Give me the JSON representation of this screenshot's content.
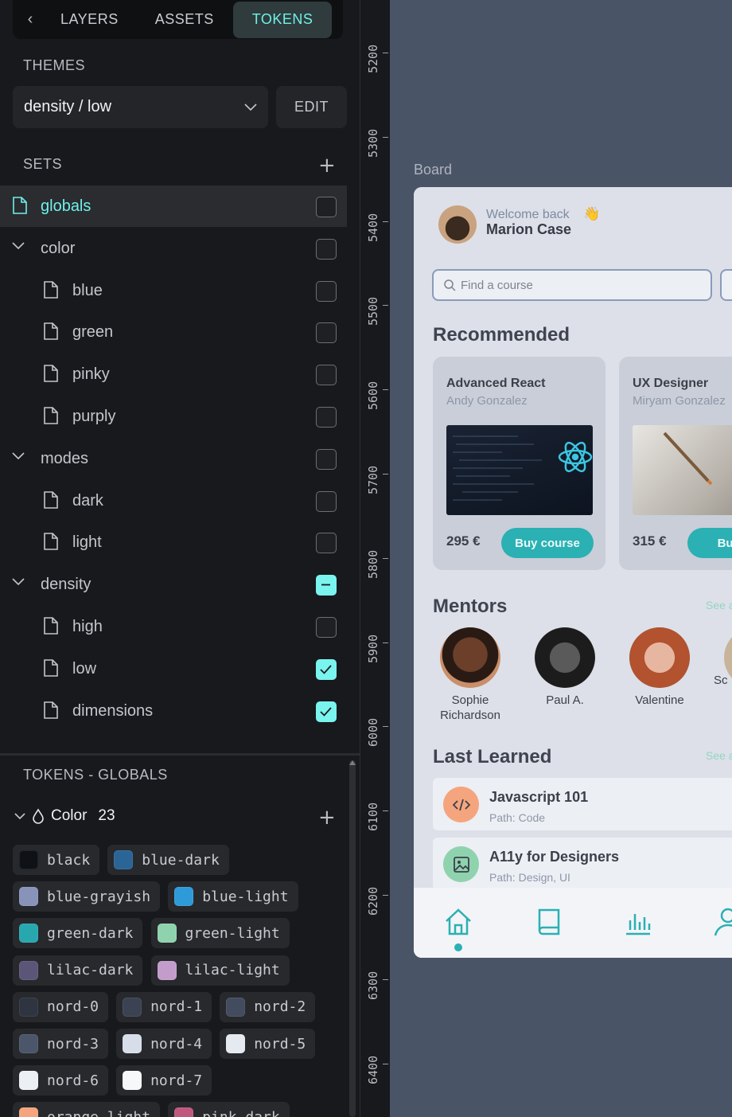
{
  "tabs": {
    "back": "‹",
    "layers": "LAYERS",
    "assets": "ASSETS",
    "tokens": "TOKENS"
  },
  "themes": {
    "title": "THEMES",
    "selected": "density / low",
    "edit": "EDIT"
  },
  "sets": {
    "title": "SETS",
    "items": [
      {
        "label": "globals",
        "type": "file",
        "state": "empty",
        "selected": true
      },
      {
        "label": "color",
        "type": "group",
        "state": "empty"
      },
      {
        "label": "blue",
        "type": "file",
        "state": "empty"
      },
      {
        "label": "green",
        "type": "file",
        "state": "empty"
      },
      {
        "label": "pinky",
        "type": "file",
        "state": "empty"
      },
      {
        "label": "purply",
        "type": "file",
        "state": "empty"
      },
      {
        "label": "modes",
        "type": "group",
        "state": "empty"
      },
      {
        "label": "dark",
        "type": "file",
        "state": "empty"
      },
      {
        "label": "light",
        "type": "file",
        "state": "empty"
      },
      {
        "label": "density",
        "type": "group",
        "state": "partial"
      },
      {
        "label": "high",
        "type": "file",
        "state": "empty"
      },
      {
        "label": "low",
        "type": "file",
        "state": "checked"
      },
      {
        "label": "dimensions",
        "type": "file",
        "state": "checked"
      }
    ]
  },
  "tokens": {
    "title": "TOKENS - GLOBALS",
    "group_label": "Color",
    "group_count": "23",
    "colors": [
      {
        "name": "black",
        "color": "#0e1116"
      },
      {
        "name": "blue-dark",
        "color": "#2b6596"
      },
      {
        "name": "blue-grayish",
        "color": "#8793b8"
      },
      {
        "name": "blue-light",
        "color": "#2f9ad8"
      },
      {
        "name": "green-dark",
        "color": "#28a7ae"
      },
      {
        "name": "green-light",
        "color": "#8fd3ae"
      },
      {
        "name": "lilac-dark",
        "color": "#5b5578"
      },
      {
        "name": "lilac-light",
        "color": "#c39ccc"
      },
      {
        "name": "nord-0",
        "color": "#2e3440"
      },
      {
        "name": "nord-1",
        "color": "#3b4252"
      },
      {
        "name": "nord-2",
        "color": "#434c5e"
      },
      {
        "name": "nord-3",
        "color": "#4c566a"
      },
      {
        "name": "nord-4",
        "color": "#d8dee9"
      },
      {
        "name": "nord-5",
        "color": "#e5e9f0"
      },
      {
        "name": "nord-6",
        "color": "#eceff4"
      },
      {
        "name": "nord-7",
        "color": "#f7f8fa"
      },
      {
        "name": "orange-light",
        "color": "#f5a57e"
      },
      {
        "name": "pink-dark",
        "color": "#c0587e"
      }
    ]
  },
  "ruler": [
    "5200",
    "5300",
    "5400",
    "5500",
    "5600",
    "5700",
    "5800",
    "5900",
    "6000",
    "6100",
    "6200",
    "6300",
    "6400"
  ],
  "board": {
    "label": "Board",
    "welcome": "Welcome back",
    "user": "Marion Case",
    "search_placeholder": "Find a course",
    "recommended": "Recommended",
    "courses": [
      {
        "title": "Advanced React",
        "author": "Andy Gonzalez",
        "price": "295 €",
        "button": "Buy course"
      },
      {
        "title": "UX Designer",
        "author": "Miryam Gonzalez",
        "price": "315 €",
        "button": "Buy c"
      }
    ],
    "mentors_title": "Mentors",
    "see_all": "See a",
    "mentors": [
      {
        "name": "Sophie Richardson"
      },
      {
        "name": "Paul A."
      },
      {
        "name": "Valentine"
      },
      {
        "name": "Sc"
      }
    ],
    "last_learned_title": "Last Learned",
    "last_learned": [
      {
        "title": "Javascript 101",
        "path": "Path: Code"
      },
      {
        "title": "A11y for Designers",
        "path": "Path: Design, UI"
      }
    ]
  },
  "accent": "#6ff0e8"
}
